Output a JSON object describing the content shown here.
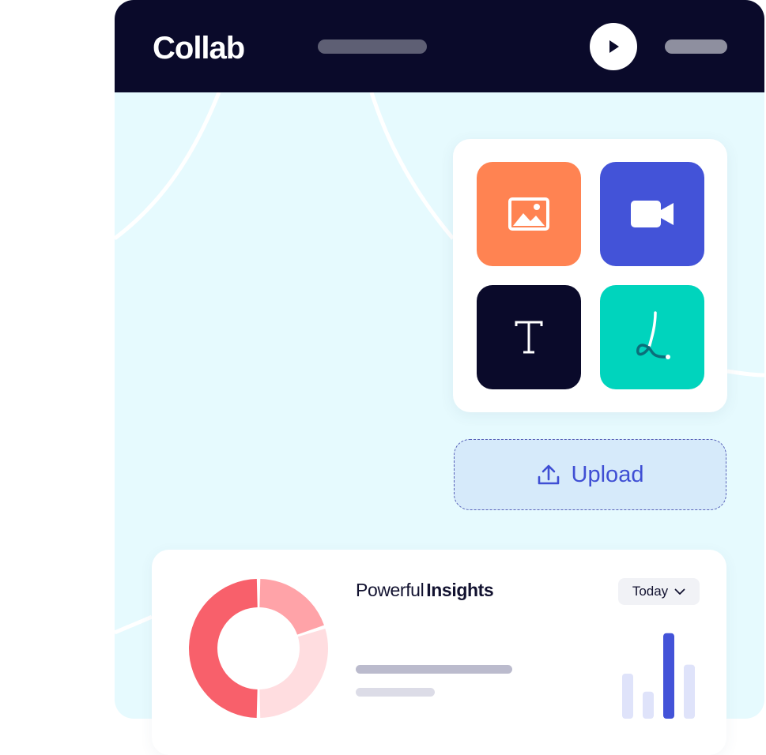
{
  "app": {
    "brand": "Collab"
  },
  "tools": [
    {
      "name": "image",
      "icon": "image-icon",
      "color": "#ff8352"
    },
    {
      "name": "video",
      "icon": "video-camera-icon",
      "color": "#4353d8"
    },
    {
      "name": "text",
      "icon": "text-icon",
      "color": "#0a0a2a"
    },
    {
      "name": "draw",
      "icon": "signature-icon",
      "color": "#00d4bd"
    }
  ],
  "upload": {
    "label": "Upload",
    "icon": "upload-icon"
  },
  "insights": {
    "title_light": "Powerful",
    "title_bold": "Insights",
    "period": "Today"
  },
  "colors": {
    "header": "#0a0a2a",
    "canvas": "#e6fafe",
    "accent": "#4353d8",
    "donut_main": "#f8606b",
    "donut_mid": "#ffa3a8",
    "donut_light": "#ffdde0",
    "bar_accent": "#4353d8",
    "bar_muted": "#dfe3fa"
  },
  "chart_data": [
    {
      "type": "pie",
      "values": [
        0.5,
        0.2,
        0.3
      ],
      "title": "",
      "legend": []
    },
    {
      "type": "bar",
      "values": [
        5,
        3,
        9.5,
        6
      ],
      "highlight_index": 2,
      "title": "",
      "xlabel": "",
      "ylabel": ""
    }
  ]
}
